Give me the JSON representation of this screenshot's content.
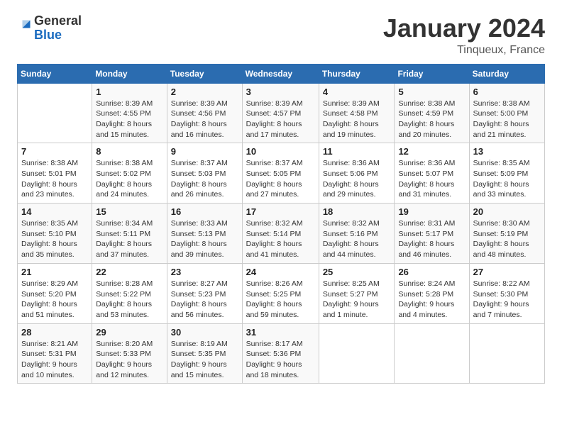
{
  "header": {
    "logo_general": "General",
    "logo_blue": "Blue",
    "month_title": "January 2024",
    "location": "Tinqueux, France"
  },
  "weekdays": [
    "Sunday",
    "Monday",
    "Tuesday",
    "Wednesday",
    "Thursday",
    "Friday",
    "Saturday"
  ],
  "weeks": [
    [
      {
        "day": "",
        "sunrise": "",
        "sunset": "",
        "daylight": ""
      },
      {
        "day": "1",
        "sunrise": "Sunrise: 8:39 AM",
        "sunset": "Sunset: 4:55 PM",
        "daylight": "Daylight: 8 hours and 15 minutes."
      },
      {
        "day": "2",
        "sunrise": "Sunrise: 8:39 AM",
        "sunset": "Sunset: 4:56 PM",
        "daylight": "Daylight: 8 hours and 16 minutes."
      },
      {
        "day": "3",
        "sunrise": "Sunrise: 8:39 AM",
        "sunset": "Sunset: 4:57 PM",
        "daylight": "Daylight: 8 hours and 17 minutes."
      },
      {
        "day": "4",
        "sunrise": "Sunrise: 8:39 AM",
        "sunset": "Sunset: 4:58 PM",
        "daylight": "Daylight: 8 hours and 19 minutes."
      },
      {
        "day": "5",
        "sunrise": "Sunrise: 8:38 AM",
        "sunset": "Sunset: 4:59 PM",
        "daylight": "Daylight: 8 hours and 20 minutes."
      },
      {
        "day": "6",
        "sunrise": "Sunrise: 8:38 AM",
        "sunset": "Sunset: 5:00 PM",
        "daylight": "Daylight: 8 hours and 21 minutes."
      }
    ],
    [
      {
        "day": "7",
        "sunrise": "Sunrise: 8:38 AM",
        "sunset": "Sunset: 5:01 PM",
        "daylight": "Daylight: 8 hours and 23 minutes."
      },
      {
        "day": "8",
        "sunrise": "Sunrise: 8:38 AM",
        "sunset": "Sunset: 5:02 PM",
        "daylight": "Daylight: 8 hours and 24 minutes."
      },
      {
        "day": "9",
        "sunrise": "Sunrise: 8:37 AM",
        "sunset": "Sunset: 5:03 PM",
        "daylight": "Daylight: 8 hours and 26 minutes."
      },
      {
        "day": "10",
        "sunrise": "Sunrise: 8:37 AM",
        "sunset": "Sunset: 5:05 PM",
        "daylight": "Daylight: 8 hours and 27 minutes."
      },
      {
        "day": "11",
        "sunrise": "Sunrise: 8:36 AM",
        "sunset": "Sunset: 5:06 PM",
        "daylight": "Daylight: 8 hours and 29 minutes."
      },
      {
        "day": "12",
        "sunrise": "Sunrise: 8:36 AM",
        "sunset": "Sunset: 5:07 PM",
        "daylight": "Daylight: 8 hours and 31 minutes."
      },
      {
        "day": "13",
        "sunrise": "Sunrise: 8:35 AM",
        "sunset": "Sunset: 5:09 PM",
        "daylight": "Daylight: 8 hours and 33 minutes."
      }
    ],
    [
      {
        "day": "14",
        "sunrise": "Sunrise: 8:35 AM",
        "sunset": "Sunset: 5:10 PM",
        "daylight": "Daylight: 8 hours and 35 minutes."
      },
      {
        "day": "15",
        "sunrise": "Sunrise: 8:34 AM",
        "sunset": "Sunset: 5:11 PM",
        "daylight": "Daylight: 8 hours and 37 minutes."
      },
      {
        "day": "16",
        "sunrise": "Sunrise: 8:33 AM",
        "sunset": "Sunset: 5:13 PM",
        "daylight": "Daylight: 8 hours and 39 minutes."
      },
      {
        "day": "17",
        "sunrise": "Sunrise: 8:32 AM",
        "sunset": "Sunset: 5:14 PM",
        "daylight": "Daylight: 8 hours and 41 minutes."
      },
      {
        "day": "18",
        "sunrise": "Sunrise: 8:32 AM",
        "sunset": "Sunset: 5:16 PM",
        "daylight": "Daylight: 8 hours and 44 minutes."
      },
      {
        "day": "19",
        "sunrise": "Sunrise: 8:31 AM",
        "sunset": "Sunset: 5:17 PM",
        "daylight": "Daylight: 8 hours and 46 minutes."
      },
      {
        "day": "20",
        "sunrise": "Sunrise: 8:30 AM",
        "sunset": "Sunset: 5:19 PM",
        "daylight": "Daylight: 8 hours and 48 minutes."
      }
    ],
    [
      {
        "day": "21",
        "sunrise": "Sunrise: 8:29 AM",
        "sunset": "Sunset: 5:20 PM",
        "daylight": "Daylight: 8 hours and 51 minutes."
      },
      {
        "day": "22",
        "sunrise": "Sunrise: 8:28 AM",
        "sunset": "Sunset: 5:22 PM",
        "daylight": "Daylight: 8 hours and 53 minutes."
      },
      {
        "day": "23",
        "sunrise": "Sunrise: 8:27 AM",
        "sunset": "Sunset: 5:23 PM",
        "daylight": "Daylight: 8 hours and 56 minutes."
      },
      {
        "day": "24",
        "sunrise": "Sunrise: 8:26 AM",
        "sunset": "Sunset: 5:25 PM",
        "daylight": "Daylight: 8 hours and 59 minutes."
      },
      {
        "day": "25",
        "sunrise": "Sunrise: 8:25 AM",
        "sunset": "Sunset: 5:27 PM",
        "daylight": "Daylight: 9 hours and 1 minute."
      },
      {
        "day": "26",
        "sunrise": "Sunrise: 8:24 AM",
        "sunset": "Sunset: 5:28 PM",
        "daylight": "Daylight: 9 hours and 4 minutes."
      },
      {
        "day": "27",
        "sunrise": "Sunrise: 8:22 AM",
        "sunset": "Sunset: 5:30 PM",
        "daylight": "Daylight: 9 hours and 7 minutes."
      }
    ],
    [
      {
        "day": "28",
        "sunrise": "Sunrise: 8:21 AM",
        "sunset": "Sunset: 5:31 PM",
        "daylight": "Daylight: 9 hours and 10 minutes."
      },
      {
        "day": "29",
        "sunrise": "Sunrise: 8:20 AM",
        "sunset": "Sunset: 5:33 PM",
        "daylight": "Daylight: 9 hours and 12 minutes."
      },
      {
        "day": "30",
        "sunrise": "Sunrise: 8:19 AM",
        "sunset": "Sunset: 5:35 PM",
        "daylight": "Daylight: 9 hours and 15 minutes."
      },
      {
        "day": "31",
        "sunrise": "Sunrise: 8:17 AM",
        "sunset": "Sunset: 5:36 PM",
        "daylight": "Daylight: 9 hours and 18 minutes."
      },
      {
        "day": "",
        "sunrise": "",
        "sunset": "",
        "daylight": ""
      },
      {
        "day": "",
        "sunrise": "",
        "sunset": "",
        "daylight": ""
      },
      {
        "day": "",
        "sunrise": "",
        "sunset": "",
        "daylight": ""
      }
    ]
  ]
}
